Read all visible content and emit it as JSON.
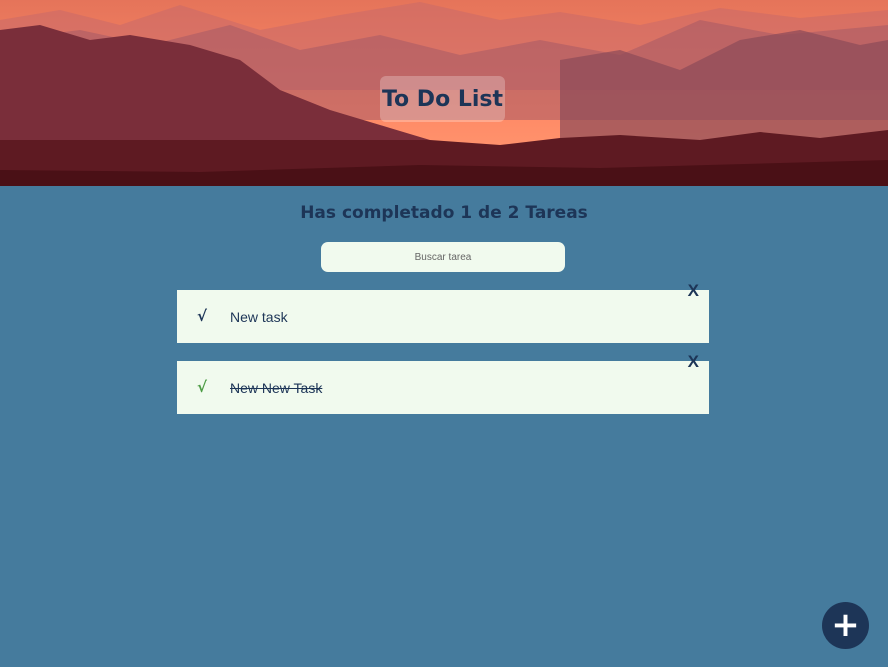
{
  "header": {
    "title": "To Do List"
  },
  "counter": {
    "text": "Has completado 1 de 2 Tareas"
  },
  "search": {
    "placeholder": "Buscar tarea",
    "value": ""
  },
  "todos": [
    {
      "check_icon": "√",
      "text": "New task",
      "completed": false,
      "delete_label": "X"
    },
    {
      "check_icon": "√",
      "text": "New New Task",
      "completed": true,
      "delete_label": "X"
    }
  ],
  "fab": {
    "label": "+"
  },
  "colors": {
    "background": "#457b9d",
    "primary": "#1d3557",
    "card": "#f1faee",
    "completed_check": "#4d9c45"
  }
}
